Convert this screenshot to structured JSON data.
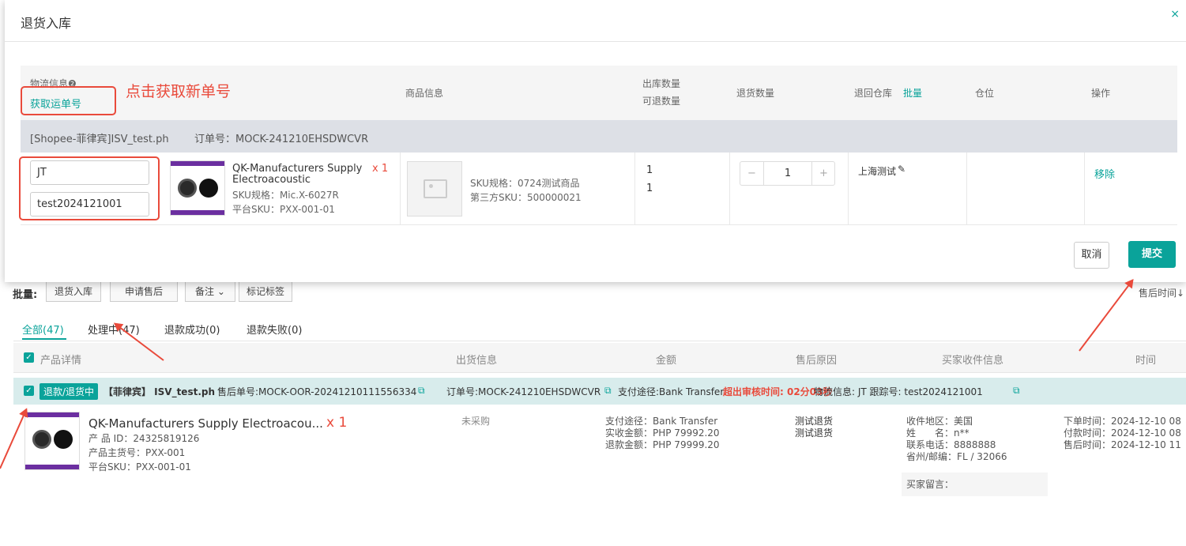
{
  "modal": {
    "title": "退货入库",
    "close": "×",
    "headers": {
      "logistics": "物流信息",
      "get_tracking": "获取运单号",
      "product_info": "商品信息",
      "out_qty": "出库数量",
      "returnable_qty": "可退数量",
      "return_qty": "退货数量",
      "return_warehouse": "退回仓库",
      "batch": "批量",
      "location": "仓位",
      "operation": "操作"
    },
    "annotation": "点击获取新单号",
    "shop": "[Shopee-菲律宾]ISV_test.ph",
    "order_no": "订单号：MOCK-241210EHSDWCVR",
    "row": {
      "carrier": "JT",
      "tracking": "test2024121001",
      "product_title": "QK-Manufacturers Supply Electroacoustic Accessorie...",
      "qty_badge": "x 1",
      "sku_spec": "SKU规格：Mic.X-6027R",
      "platform_sku": "平台SKU：PXX-001-01",
      "goods_sku_spec": "SKU规格：0724测试商品",
      "third_sku": "第三方SKU：500000021",
      "out_qty": "1",
      "returnable_qty": "1",
      "stepper_minus": "−",
      "stepper_value": "1",
      "stepper_plus": "+",
      "warehouse": "上海测试",
      "remove": "移除"
    },
    "cancel": "取消",
    "submit": "提交"
  },
  "page": {
    "batch_label": "批量:",
    "toolbar": [
      "退货入库",
      "申请售后",
      "备注",
      "标记标签"
    ],
    "sort": "售后时间↓",
    "tabs": [
      "全部(47)",
      "处理中(47)",
      "退款成功(0)",
      "退款失败(0)"
    ],
    "headers": [
      "产品详情",
      "出货信息",
      "金额",
      "售后原因",
      "买家收件信息",
      "时间"
    ],
    "order": {
      "status": "退款/退货中",
      "country_shop": "【菲律宾】 ISV_test.ph",
      "aftersale_no": "售后单号:MOCK-OOR-20241210111556334",
      "order_no": "订单号:MOCK-241210EHSDWCVR",
      "payment": "支付途径:Bank Transfer",
      "overdue": "超出审核时间: 02分03秒",
      "logistics": "物流信息: JT 跟踪号: test2024121001"
    },
    "product": {
      "title": "QK-Manufacturers Supply Electroacou...",
      "qty": "x 1",
      "product_id": "产 品 ID：24325819126",
      "main_sku": "产品主货号：PXX-001",
      "platform_sku": "平台SKU：PXX-001-01"
    },
    "shipping": "未采购",
    "amount": [
      "支付途径：Bank Transfer",
      "实收金额：PHP 79992.20",
      "退款金额：PHP 79999.20"
    ],
    "reason": [
      "测试退货",
      "测试退货"
    ],
    "buyer": [
      "收件地区：美国",
      "姓　　名：n**",
      "联系电话：8888888",
      "省州/邮编：FL / 32066"
    ],
    "buyer_note": "买家留言：",
    "times": [
      "下单时间：2024-12-10 08",
      "付款时间：2024-12-10 08",
      "售后时间：2024-12-10 11"
    ]
  },
  "colors": {
    "accent": "#0aa39a",
    "annotation": "#e94a3b",
    "overdue": "#e94a3b"
  }
}
